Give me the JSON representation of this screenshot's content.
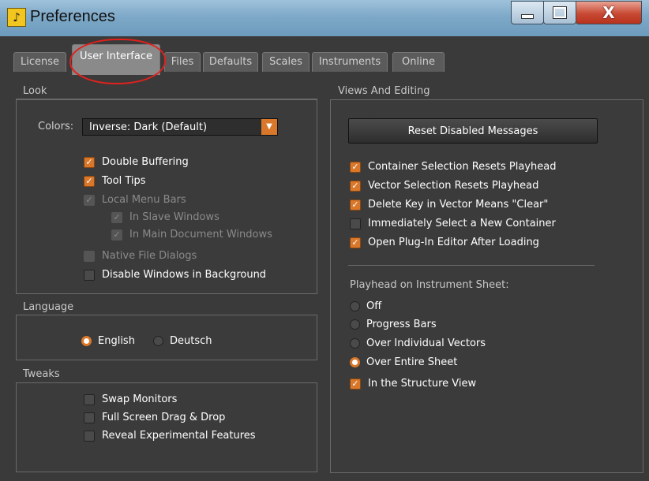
{
  "window": {
    "title": "Preferences",
    "app_icon": "finale-icon"
  },
  "tabs": [
    {
      "label": "License"
    },
    {
      "label": "User Interface",
      "active": true
    },
    {
      "label": "Files"
    },
    {
      "label": "Defaults"
    },
    {
      "label": "Scales"
    },
    {
      "label": "Instruments"
    },
    {
      "label": "Online"
    }
  ],
  "look": {
    "header": "Look",
    "colors_label": "Colors:",
    "colors_value": "Inverse: Dark (Default)",
    "options": [
      {
        "label": "Double Buffering",
        "checked": true,
        "enabled": true
      },
      {
        "label": "Tool Tips",
        "checked": true,
        "enabled": true
      },
      {
        "label": "Local Menu Bars",
        "checked": true,
        "enabled": false
      },
      {
        "label": "In Slave Windows",
        "checked": true,
        "enabled": false
      },
      {
        "label": "In Main Document Windows",
        "checked": true,
        "enabled": false
      },
      {
        "label": "Native File Dialogs",
        "checked": false,
        "enabled": false
      },
      {
        "label": "Disable Windows in Background",
        "checked": false,
        "enabled": true
      }
    ]
  },
  "language": {
    "header": "Language",
    "options": [
      {
        "label": "English",
        "selected": true
      },
      {
        "label": "Deutsch",
        "selected": false
      }
    ]
  },
  "tweaks": {
    "header": "Tweaks",
    "options": [
      {
        "label": "Swap Monitors",
        "checked": false
      },
      {
        "label": "Full Screen Drag & Drop",
        "checked": false
      },
      {
        "label": "Reveal Experimental Features",
        "checked": false
      }
    ]
  },
  "views": {
    "header": "Views And Editing",
    "reset_button": "Reset Disabled Messages",
    "options": [
      {
        "label": "Container Selection Resets Playhead",
        "checked": true
      },
      {
        "label": "Vector Selection Resets Playhead",
        "checked": true
      },
      {
        "label": "Delete Key in Vector Means \"Clear\"",
        "checked": true
      },
      {
        "label": "Immediately Select a New Container",
        "checked": false
      },
      {
        "label": "Open Plug-In Editor After Loading",
        "checked": true
      }
    ],
    "playhead_label": "Playhead on Instrument Sheet:",
    "playhead_options": [
      {
        "label": "Off",
        "selected": false
      },
      {
        "label": "Progress Bars",
        "selected": false
      },
      {
        "label": "Over Individual Vectors",
        "selected": false
      },
      {
        "label": "Over Entire Sheet",
        "selected": true
      }
    ],
    "structure_view": {
      "label": "In the Structure View",
      "checked": true
    }
  },
  "colors": {
    "accent": "#d9782a",
    "annotation": "#e0211d"
  }
}
